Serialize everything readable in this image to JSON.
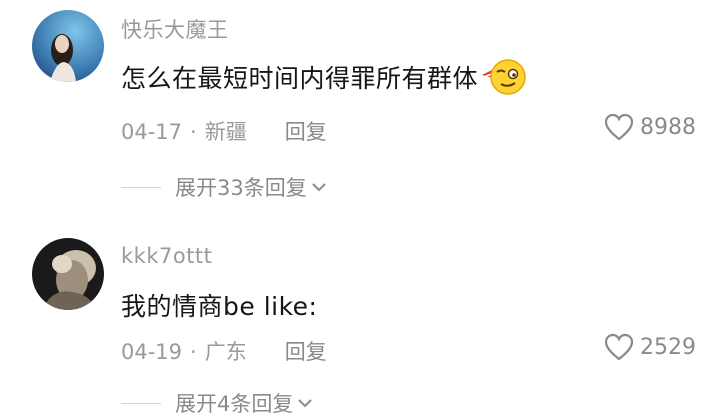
{
  "comments": [
    {
      "username": "快乐大魔王",
      "text": "怎么在最短时间内得罪所有群体",
      "emoji_icon": "smirk-face-emoji",
      "date": "04-17",
      "location": "新疆",
      "reply_label": "回复",
      "likes": "8988",
      "expand_label": "展开33条回复"
    },
    {
      "username": "kkk7ottt",
      "text": "我的情商be like:",
      "date": "04-19",
      "location": "广东",
      "reply_label": "回复",
      "likes": "2529",
      "expand_label": "展开4条回复"
    }
  ],
  "separator": "·",
  "colors": {
    "username": "#9a9a9a",
    "text": "#161616",
    "meta": "#9a9a9a",
    "divider": "#d6d6d6"
  }
}
